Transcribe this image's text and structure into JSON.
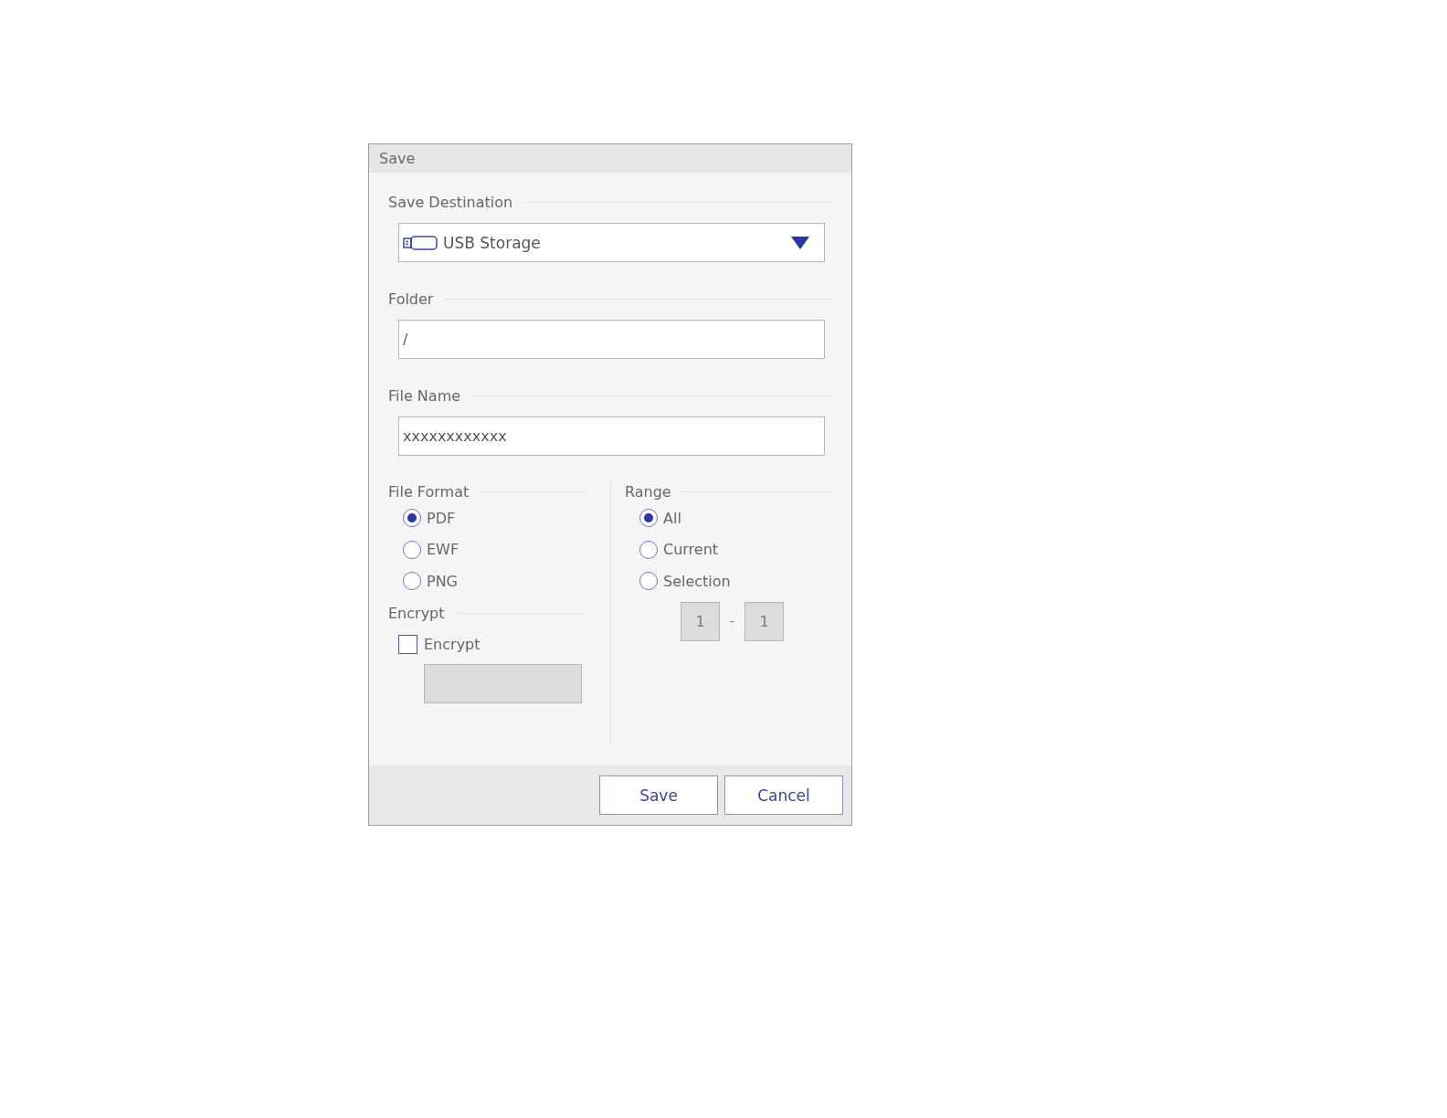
{
  "window": {
    "title": "Save"
  },
  "save_destination": {
    "label": "Save Destination",
    "value": "USB Storage"
  },
  "folder": {
    "label": "Folder",
    "value": "/"
  },
  "file_name": {
    "label": "File Name",
    "value": "xxxxxxxxxxxx"
  },
  "file_format": {
    "label": "File Format",
    "options": [
      {
        "label": "PDF",
        "selected": true
      },
      {
        "label": "EWF",
        "selected": false
      },
      {
        "label": "PNG",
        "selected": false
      }
    ]
  },
  "encrypt": {
    "label": "Encrypt",
    "checkbox": {
      "label": "Encrypt",
      "checked": false
    },
    "password_field": {
      "disabled": true
    }
  },
  "range": {
    "label": "Range",
    "options": [
      {
        "label": "All",
        "selected": true
      },
      {
        "label": "Current",
        "selected": false
      },
      {
        "label": "Selection",
        "selected": false
      }
    ],
    "from": {
      "value": "1",
      "disabled": true
    },
    "separator": "-",
    "to": {
      "value": "1",
      "disabled": true
    }
  },
  "buttons": [
    "Save",
    "Cancel"
  ]
}
